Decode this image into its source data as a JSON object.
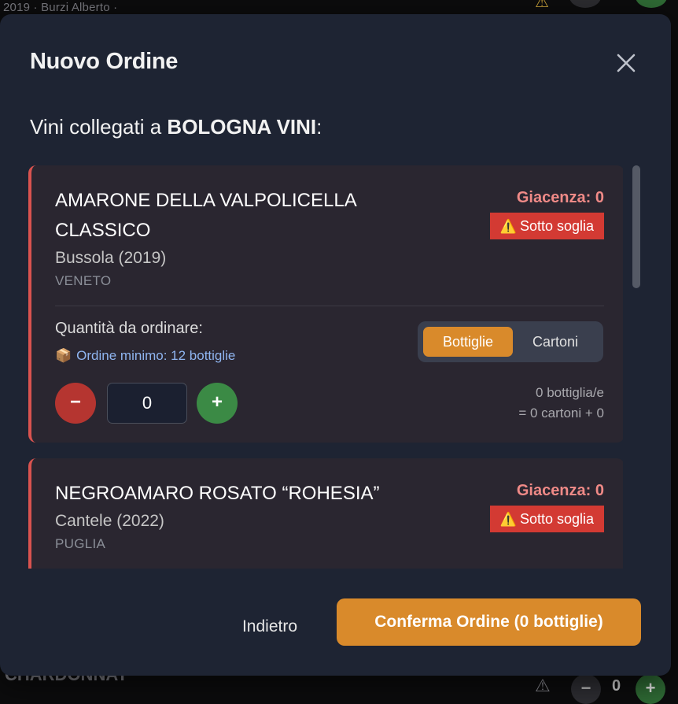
{
  "background": {
    "top_breadcrumb": "2019 · Burzi Alberto ·",
    "bottom_label": "CHARDONNAY",
    "bottom_qty": "0",
    "bottom_minus": "−",
    "bottom_plus": "+",
    "warn_glyph": "⚠"
  },
  "modal": {
    "title": "Nuovo Ordine",
    "close_icon": "close-icon",
    "subtitle_prefix": "Vini collegati a ",
    "supplier": "BOLOGNA VINI",
    "subtitle_suffix": ":",
    "wines": [
      {
        "name": "AMARONE DELLA VALPOLICELLA CLASSICO",
        "producer": "Bussola (2019)",
        "region": "VENETO",
        "stock_label": "Giacenza: 0",
        "badge_icon": "⚠️",
        "badge_label": "Sotto soglia",
        "quantity_label": "Quantità da ordinare:",
        "min_order_icon": "📦",
        "min_order": "Ordine minimo: 12 bottiglie",
        "unit_bottles": "Bottiglie",
        "unit_cartons": "Cartoni",
        "selected_unit": "Bottiglie",
        "minus": "−",
        "quantity": "0",
        "plus": "+",
        "summary_line1": "0 bottiglia/e",
        "summary_line2": "= 0 cartoni + 0"
      },
      {
        "name": "NEGROAMARO ROSATO “ROHESIA”",
        "producer": "Cantele (2022)",
        "region": "PUGLIA",
        "stock_label": "Giacenza: 0",
        "badge_icon": "⚠️",
        "badge_label": "Sotto soglia"
      }
    ],
    "back_label": "Indietro",
    "confirm_label": "Conferma Ordine (0 bottiglie)"
  },
  "colors": {
    "modal_bg": "#1e2433",
    "card_bg": "#2a2630",
    "card_accent": "#d9534f",
    "accent_orange": "#d98a2b",
    "danger": "#d33a33",
    "success": "#3b8a45",
    "stock_text": "#f08a87",
    "link_blue": "#8fb5f0"
  }
}
